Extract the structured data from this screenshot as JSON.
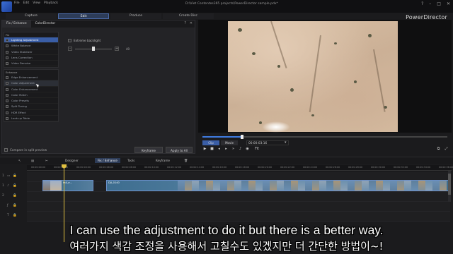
{
  "window": {
    "menu": [
      "File",
      "Edit",
      "View",
      "Playback"
    ],
    "file_path": "D:\\Viet Contentes365 projects\\PowerDirector sample.pdx*",
    "brand": "PowerDirector",
    "controls": [
      "?",
      "–",
      "□",
      "✕"
    ]
  },
  "main_tabs": [
    {
      "label": "Capture",
      "active": false
    },
    {
      "label": "Edit",
      "active": true
    },
    {
      "label": "Produce",
      "active": false
    },
    {
      "label": "Create Disc",
      "active": false
    }
  ],
  "fix_panel": {
    "tabs": [
      {
        "label": "Fix / Enhance",
        "active": true
      },
      {
        "label": "ColorDirector",
        "active": false
      }
    ],
    "fix_group_label": "Fix",
    "fix_items": [
      {
        "label": "Lighting Adjustment",
        "selected": true
      },
      {
        "label": "White Balance",
        "selected": false
      },
      {
        "label": "Video Stabilizer",
        "selected": false
      },
      {
        "label": "Lens Correction",
        "selected": false
      },
      {
        "label": "Video Denoise",
        "selected": false
      }
    ],
    "enhance_group_label": "Enhance",
    "enhance_items": [
      {
        "label": "Edge Enhancement",
        "selected": false
      },
      {
        "label": "Color Adjustment",
        "selected": false,
        "hover": true
      },
      {
        "label": "Color Enhancement",
        "selected": false
      },
      {
        "label": "Color Match",
        "selected": false
      },
      {
        "label": "Color Presets",
        "selected": false
      },
      {
        "label": "Split Toning",
        "selected": false
      },
      {
        "label": "HDR Effect",
        "selected": false
      },
      {
        "label": "Look-up Table",
        "selected": false
      }
    ],
    "option_label": "Extreme backlight",
    "slider": {
      "value_label": "40",
      "fraction": 0.5
    },
    "compare_label": "Compare in split preview",
    "keyframe_button": "Keyframe",
    "apply_all_button": "Apply to All"
  },
  "preview": {
    "mode_buttons": [
      {
        "label": "Clip",
        "active": true
      },
      {
        "label": "Movie",
        "active": false
      }
    ],
    "timecode": "00:00:03:16",
    "zoom": "Fit",
    "progress_fraction": 0.16
  },
  "timeline_toolbar": {
    "designer": "Designer",
    "fix_enhance": "Fix / Enhance",
    "tools": "Tools",
    "keyframe": "Keyframe"
  },
  "ruler_labels": [
    "00:00:00:00",
    "00:00:02:00",
    "00:00:04:00",
    "00:00:06:00",
    "00:00:08:00",
    "00:00:10:00",
    "00:00:12:00",
    "00:00:14:00",
    "00:00:16:00",
    "00:00:18:00",
    "00:00:20:00",
    "00:00:22:00",
    "00:00:24:00",
    "00:00:26:00",
    "00:00:28:00",
    "00:00:30:00",
    "00:00:32:00",
    "00:00:34:00",
    "00:00:36:00"
  ],
  "clips": {
    "clip1_name": "tall_e...",
    "clip2_name": "DJI_0140"
  },
  "colors": {
    "accent": "#3a5ea6",
    "playhead": "#e0c040",
    "clip_border": "#6a8fc9"
  },
  "subtitles": {
    "english": "I can use the adjustment to do it but there is a better way.",
    "korean": "여러가지 색감 조정을 사용해서 고칠수도 있겠지만 더 간단한 방법이~!"
  }
}
